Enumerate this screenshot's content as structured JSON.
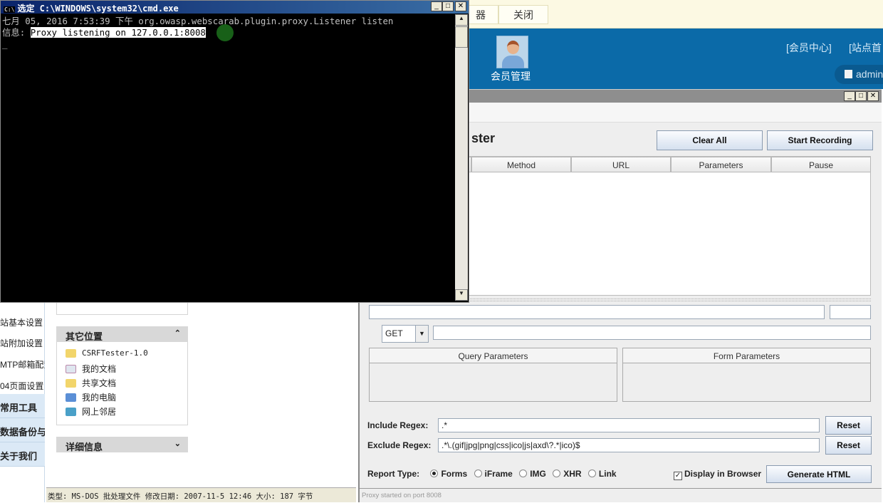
{
  "browser": {
    "button_partial": "器",
    "close_button": "关闭"
  },
  "header": {
    "member_mgmt": "会员管理",
    "member_center": "[会员中心]",
    "site_home": "[站点首",
    "admin": "admin"
  },
  "sidebar": {
    "items": [
      {
        "label": "站基本设置"
      },
      {
        "label": "站附加设置"
      },
      {
        "label": "MTP邮箱配置"
      },
      {
        "label": "04页面设置"
      },
      {
        "label": "常用工具",
        "bold": true
      },
      {
        "label": "数据备份与",
        "bold": true
      },
      {
        "label": "关于我们",
        "bold": true
      }
    ]
  },
  "explorer": {
    "other_places": {
      "title": "其它位置",
      "items": [
        {
          "label": "CSRFTester-1.0",
          "icon": "folder-icon"
        },
        {
          "label": "我的文档",
          "icon": "documents-icon"
        },
        {
          "label": "共享文档",
          "icon": "folder-icon"
        },
        {
          "label": "我的电脑",
          "icon": "computer-icon"
        },
        {
          "label": "网上邻居",
          "icon": "network-icon"
        }
      ]
    },
    "details": {
      "title": "详细信息"
    },
    "status": "类型: MS-DOS 批处理文件 修改日期: 2007-11-5 12:46 大小: 187 字节"
  },
  "csrf": {
    "title_partial": "ster",
    "clear_all": "Clear All",
    "start_recording": "Start Recording",
    "columns": [
      "Method",
      "URL",
      "Parameters",
      "Pause"
    ],
    "method_value": "GET",
    "query_params": "Query Parameters",
    "form_params": "Form Parameters",
    "include_label": "Include Regex:",
    "include_value": ".*",
    "exclude_label": "Exclude Regex:",
    "exclude_value": ".*\\.(gif|jpg|png|css|ico|js|axd\\?.*|ico)$",
    "reset": "Reset",
    "report_type": "Report Type:",
    "report_options": [
      {
        "label": "Forms",
        "selected": true
      },
      {
        "label": "iFrame"
      },
      {
        "label": "IMG"
      },
      {
        "label": "XHR"
      },
      {
        "label": "Link"
      }
    ],
    "display_in_browser": "Display in Browser",
    "display_checked": true,
    "generate_html": "Generate HTML",
    "status": "Proxy started on port 8008"
  },
  "cmd": {
    "title": "选定 C:\\WINDOWS\\system32\\cmd.exe",
    "line1": "七月 05, 2016 7:53:39 下午 org.owasp.webscarab.plugin.proxy.Listener listen",
    "line2_prefix": "信息: ",
    "line2_selected": "Proxy listening on 127.0.0.1:8008"
  }
}
